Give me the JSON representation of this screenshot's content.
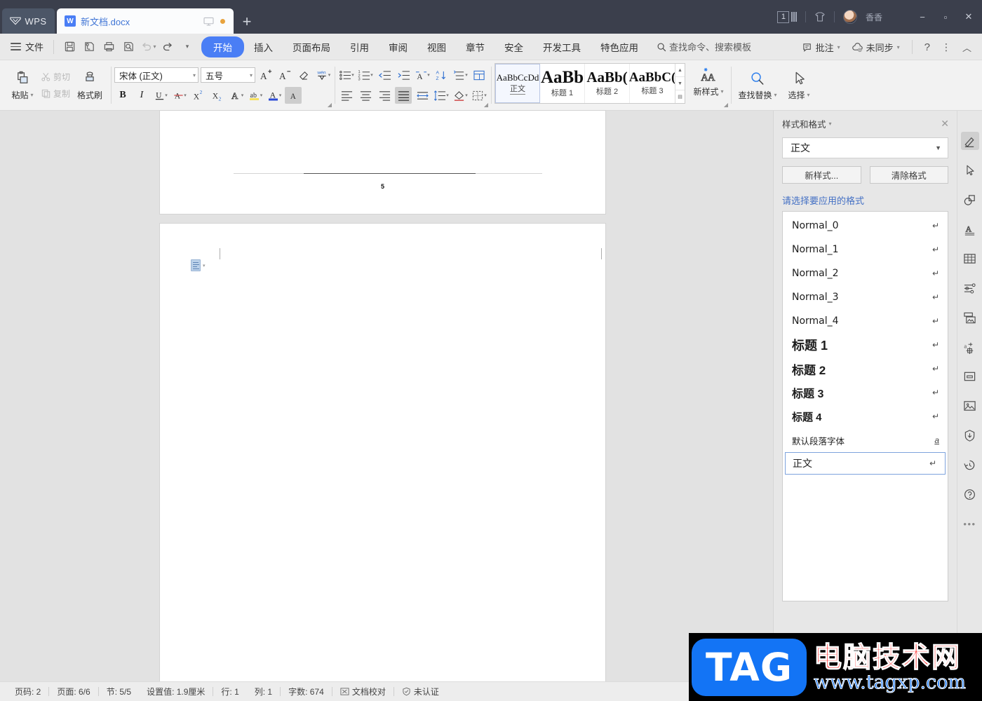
{
  "titlebar": {
    "app_badge": "WPS",
    "tab_name": "新文档.docx",
    "new_tab": "+",
    "doc_count": "1",
    "user_name": "香香",
    "window_minimize": "−",
    "window_maximize": "▫",
    "window_close": "✕"
  },
  "menubar": {
    "file": "文件",
    "quick_access": [
      "save-icon",
      "save-as-icon",
      "print-icon",
      "print-preview-icon",
      "undo-icon",
      "redo-icon",
      "customize-icon"
    ],
    "tabs": [
      {
        "label": "开始",
        "active": true
      },
      {
        "label": "插入",
        "active": false
      },
      {
        "label": "页面布局",
        "active": false
      },
      {
        "label": "引用",
        "active": false
      },
      {
        "label": "审阅",
        "active": false
      },
      {
        "label": "视图",
        "active": false
      },
      {
        "label": "章节",
        "active": false
      },
      {
        "label": "安全",
        "active": false
      },
      {
        "label": "开发工具",
        "active": false
      },
      {
        "label": "特色应用",
        "active": false
      }
    ],
    "search_placeholder": "查找命令、搜索模板",
    "right_items": [
      {
        "label": "批注",
        "icon": "comment-icon"
      },
      {
        "label": "未同步",
        "icon": "cloud-off-icon"
      }
    ],
    "help": "?",
    "more": "⋮",
    "collapse": "︿"
  },
  "ribbon": {
    "clipboard": {
      "paste": "粘贴",
      "cut": "剪切",
      "copy": "复制",
      "format_painter": "格式刷"
    },
    "font": {
      "font_family": "宋体 (正文)",
      "font_size": "五号",
      "bold": "B",
      "italic": "I",
      "underline": "U",
      "strikethrough": "A",
      "superscript": "X²",
      "subscript": "X₂",
      "grow_font": "A⁺",
      "shrink_font": "A⁻",
      "clear_format": "clear-format-icon",
      "pinyin": "拼音指南",
      "char_border": "字符边框",
      "highlight": "突出显示",
      "font_color": "字体颜色",
      "char_shading": "字符底纹"
    },
    "paragraph": {
      "bullets": "项目符号",
      "numbering": "编号",
      "decrease_indent": "减少缩进",
      "increase_indent": "增加缩进",
      "asian_layout": "中文版式",
      "sort": "排序",
      "show_marks": "显示段落标记",
      "align_left": "左对齐",
      "align_center": "居中对齐",
      "align_right": "右对齐",
      "justify": "两端对齐",
      "distribute": "分散对齐",
      "line_spacing": "行距",
      "shading": "底纹",
      "borders": "边框"
    },
    "styles_gallery": [
      {
        "preview": "AaBbCcDd",
        "name": "正文",
        "selected": true
      },
      {
        "preview": "AaBb",
        "name": "标题 1",
        "selected": false
      },
      {
        "preview": "AaBb(",
        "name": "标题 2",
        "selected": false
      },
      {
        "preview": "AaBbC(",
        "name": "标题 3",
        "selected": false
      }
    ],
    "new_style": "新样式",
    "find_replace": "查找替换",
    "select": "选择"
  },
  "document": {
    "page_number_shown": "5",
    "doc_icon": "document-options-icon"
  },
  "taskpane": {
    "title": "样式和格式",
    "close": "✕",
    "current_style": "正文",
    "new_style_button": "新样式...",
    "clear_format_button": "清除格式",
    "hint": "请选择要应用的格式",
    "styles": [
      {
        "label": "Normal_0",
        "mark": "↵",
        "kind": "normal",
        "selected": false
      },
      {
        "label": "Normal_1",
        "mark": "↵",
        "kind": "normal",
        "selected": false
      },
      {
        "label": "Normal_2",
        "mark": "↵",
        "kind": "normal",
        "selected": false
      },
      {
        "label": "Normal_3",
        "mark": "↵",
        "kind": "normal",
        "selected": false
      },
      {
        "label": "Normal_4",
        "mark": "↵",
        "kind": "normal",
        "selected": false
      },
      {
        "label": "标题 1",
        "mark": "↵",
        "kind": "h1",
        "selected": false
      },
      {
        "label": "标题 2",
        "mark": "↵",
        "kind": "h2",
        "selected": false
      },
      {
        "label": "标题 3",
        "mark": "↵",
        "kind": "h3",
        "selected": false
      },
      {
        "label": "标题 4",
        "mark": "↵",
        "kind": "h4",
        "selected": false
      },
      {
        "label": "默认段落字体",
        "mark": "a",
        "kind": "def",
        "selected": false
      },
      {
        "label": "正文",
        "mark": "↵",
        "kind": "zw",
        "selected": true
      }
    ]
  },
  "rail": {
    "items": [
      {
        "name": "highlighter-pen-icon",
        "active": true
      },
      {
        "name": "cursor-select-icon",
        "active": false
      },
      {
        "name": "shapes-icon",
        "active": false
      },
      {
        "name": "text-art-icon",
        "active": false
      },
      {
        "name": "table-icon",
        "active": false
      },
      {
        "name": "settings-sliders-icon",
        "active": false
      },
      {
        "name": "image-gallery-icon",
        "active": false
      },
      {
        "name": "text-to-shape-icon",
        "active": false
      },
      {
        "name": "box-archive-icon",
        "active": false
      },
      {
        "name": "picture-icon",
        "active": false
      },
      {
        "name": "shield-badge-icon",
        "active": false
      },
      {
        "name": "history-clock-icon",
        "active": false
      },
      {
        "name": "help-circle-icon",
        "active": false
      }
    ],
    "more": "•••"
  },
  "statusbar": {
    "items": [
      {
        "label": "页码: 2"
      },
      {
        "label": "页面: 6/6"
      },
      {
        "label": "节: 5/5"
      },
      {
        "label": "设置值: 1.9厘米"
      },
      {
        "label": "行: 1"
      },
      {
        "label": "列: 1"
      },
      {
        "label": "字数: 674"
      },
      {
        "label": "文档校对",
        "icon": "proofread-icon"
      },
      {
        "label": "未认证",
        "icon": "shield-icon"
      }
    ],
    "fullscreen": "fullscreen-icon"
  },
  "watermark": {
    "tag": "TAG",
    "cn_text": "电脑技术网",
    "url": "www.tagxp.com"
  },
  "colors": {
    "titlebar_bg": "#3b3f4c",
    "accent_blue": "#4a7ef5",
    "menubar_bg": "#e9e9e9",
    "ribbon_bg": "#f2f2f2",
    "workspace_bg": "#e2e2e2",
    "page_white": "#ffffff",
    "panel_bg": "#e7e7e7",
    "hint_blue": "#4470c4",
    "watermark_red": "#ff0000",
    "watermark_blue": "#1374f5"
  }
}
